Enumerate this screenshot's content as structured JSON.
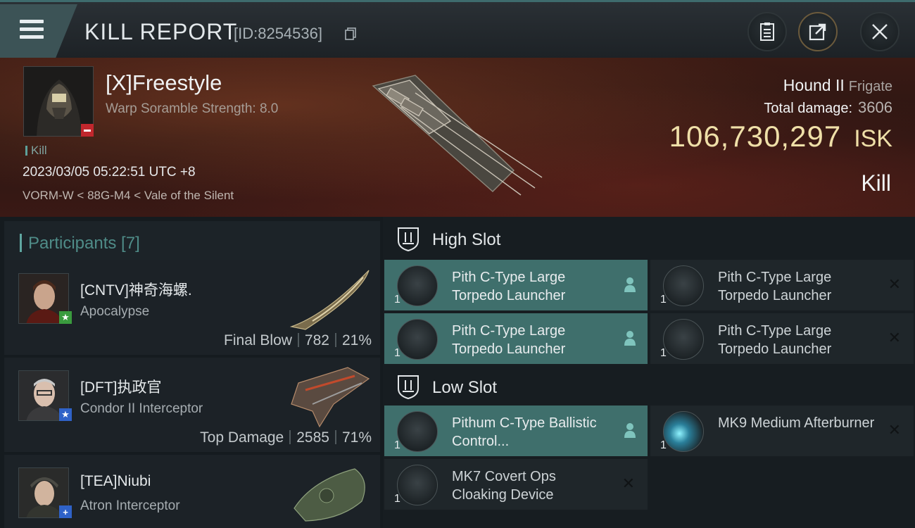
{
  "header": {
    "title": "KILL REPORT",
    "report_id": "[ID:8254536]",
    "icons": [
      "menu-icon",
      "copy-icon",
      "clipboard-icon",
      "share-icon",
      "close-icon"
    ]
  },
  "victim": {
    "name": "[X]Freestyle",
    "scramble": "Warp Soramble Strength: 8.0",
    "tag": "Kill",
    "datetime": "2023/03/05 05:22:51 UTC +8",
    "location": "VORM-W < 88G-M4 < Vale of the Silent",
    "ship_name": "Hound II",
    "ship_class": "Frigate",
    "total_damage_label": "Total damage:",
    "total_damage": "3606",
    "isk_value": "106,730,297",
    "isk_unit": "ISK",
    "result": "Kill"
  },
  "participants": {
    "header": "Participants [7]",
    "rows": [
      {
        "name": "[CNTV]神奇海螺.",
        "ship": "Apocalypse",
        "role": "Final Blow",
        "damage": "782",
        "percent": "21%",
        "badge": "★"
      },
      {
        "name": "[DFT]执政官",
        "ship": "Condor II Interceptor",
        "role": "Top Damage",
        "damage": "2585",
        "percent": "71%",
        "badge": "★"
      },
      {
        "name": "[TEA]Niubi",
        "ship": "Atron Interceptor",
        "role": "",
        "damage": "",
        "percent": "",
        "badge": "+"
      }
    ]
  },
  "slots": {
    "high": {
      "label": "High Slot",
      "modules": [
        {
          "name": "Pith C-Type Large Torpedo Launcher",
          "qty": "1",
          "fitted": true
        },
        {
          "name": "Pith C-Type Large Torpedo Launcher",
          "qty": "1",
          "fitted": false
        },
        {
          "name": "Pith C-Type Large Torpedo Launcher",
          "qty": "1",
          "fitted": true
        },
        {
          "name": "Pith C-Type Large Torpedo Launcher",
          "qty": "1",
          "fitted": false
        }
      ]
    },
    "low": {
      "label": "Low Slot",
      "modules": [
        {
          "name": "Pithum C-Type Ballistic Control...",
          "qty": "1",
          "fitted": true
        },
        {
          "name": "MK9 Medium Afterburner",
          "qty": "1",
          "fitted": false
        },
        {
          "name": "MK7 Covert Ops Cloaking Device",
          "qty": "1",
          "fitted": false
        }
      ]
    }
  },
  "colors": {
    "accent_teal": "#3f6f6c",
    "isk_gold": "#efdfa8",
    "badge_green": "#3a9b3e",
    "badge_blue": "#2f62c8",
    "badge_red": "#c1272d"
  }
}
